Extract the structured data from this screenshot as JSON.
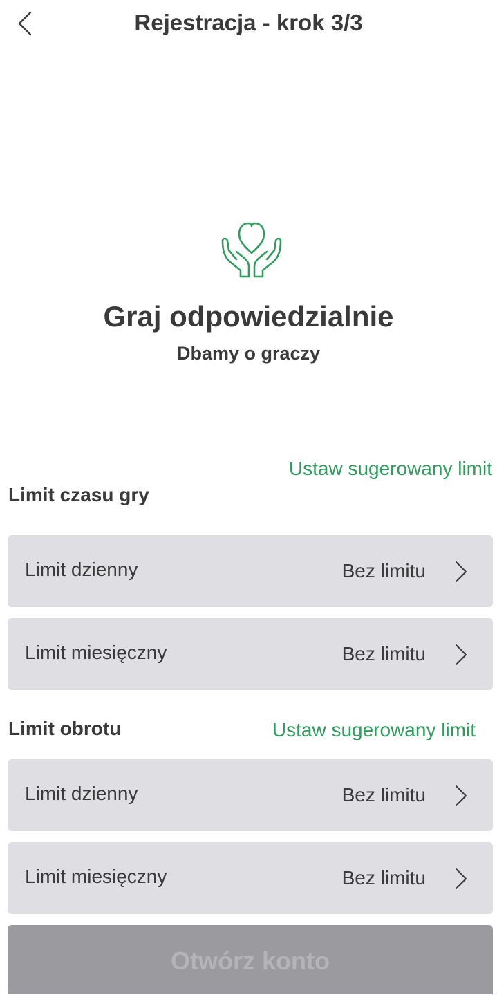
{
  "header": {
    "title": "Rejestracja - krok 3/3",
    "back_icon": "chevron-left-icon"
  },
  "hero": {
    "icon": "hands-heart-icon",
    "icon_color": "#2e9d5b",
    "title": "Graj odpowiedzialnie",
    "subtitle": "Dbamy o graczy"
  },
  "sections": [
    {
      "title": "Limit czasu gry",
      "suggest_label": "Ustaw sugerowany limit",
      "rows": [
        {
          "label": "Limit dzienny",
          "value": "Bez limitu"
        },
        {
          "label": "Limit miesięczny",
          "value": "Bez limitu"
        }
      ]
    },
    {
      "title": "Limit obrotu",
      "suggest_label": "Ustaw sugerowany limit",
      "rows": [
        {
          "label": "Limit dzienny",
          "value": "Bez limitu"
        },
        {
          "label": "Limit miesięczny",
          "value": "Bez limitu"
        }
      ]
    }
  ],
  "footer": {
    "open_account_label": "Otwórz konto"
  },
  "colors": {
    "accent": "#2e9d5b",
    "row_background": "#dfdfe3",
    "button_disabled": "#9b9b9f",
    "text": "#3a3a3a"
  }
}
